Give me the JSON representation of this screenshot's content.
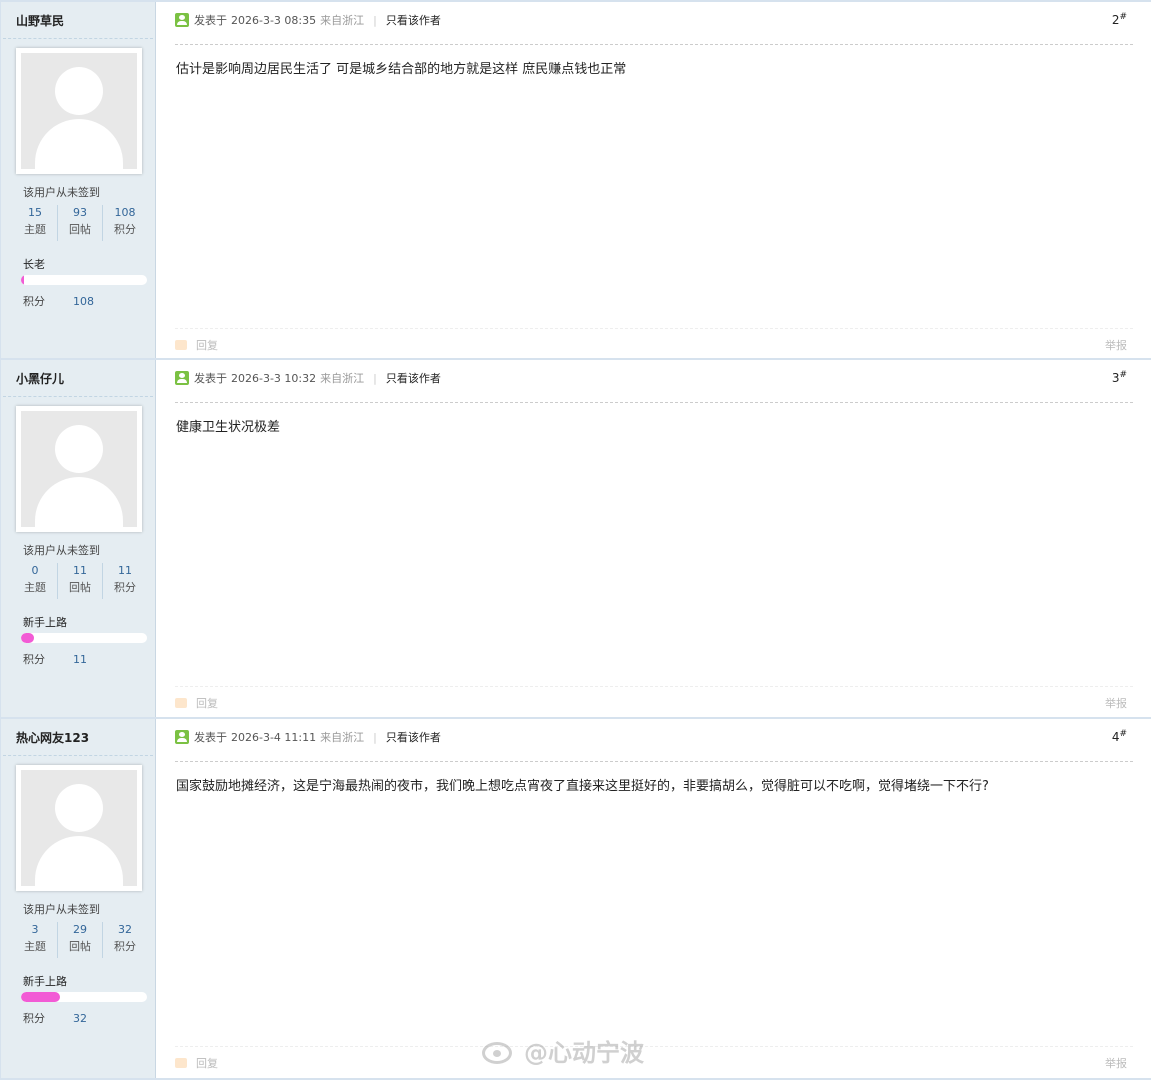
{
  "labels": {
    "posted_prefix": "发表于",
    "author_only": "只看该作者",
    "reply": "回复",
    "report": "举报",
    "never_signed": "该用户从未签到",
    "topics": "主题",
    "replies": "回帖",
    "points": "积分"
  },
  "posts": [
    {
      "username": "山野草民",
      "topics": "15",
      "replies": "93",
      "points": "108",
      "rank": "长老",
      "rank_progress": 0.02,
      "time": "2026-3-3 08:35",
      "location": "来自浙江",
      "floor": "2",
      "floor_mark": "#",
      "content": "估计是影响周边居民生活了 可是城乡结合部的地方就是这样 庶民赚点钱也正常"
    },
    {
      "username": "小黑仔儿",
      "topics": "0",
      "replies": "11",
      "points": "11",
      "rank": "新手上路",
      "rank_progress": 0.1,
      "time": "2026-3-3 10:32",
      "location": "来自浙江",
      "floor": "3",
      "floor_mark": "#",
      "content": "健康卫生状况极差"
    },
    {
      "username": "热心网友123",
      "topics": "3",
      "replies": "29",
      "points": "32",
      "rank": "新手上路",
      "rank_progress": 0.31,
      "time": "2026-3-4 11:11",
      "location": "来自浙江",
      "floor": "4",
      "floor_mark": "#",
      "content": "国家鼓励地摊经济，这是宁海最热闹的夜市，我们晚上想吃点宵夜了直接来这里挺好的，非要搞胡么，觉得脏可以不吃啊，觉得堵绕一下不行?"
    }
  ],
  "watermark": {
    "text": "@心动宁波",
    "icon": "weibo-logo-icon"
  },
  "colors": {
    "sidebar_bg": "#e5edf2",
    "stat_number": "#336699",
    "rank_bar": "#f25bd5",
    "online_icon": "#7bc143"
  }
}
